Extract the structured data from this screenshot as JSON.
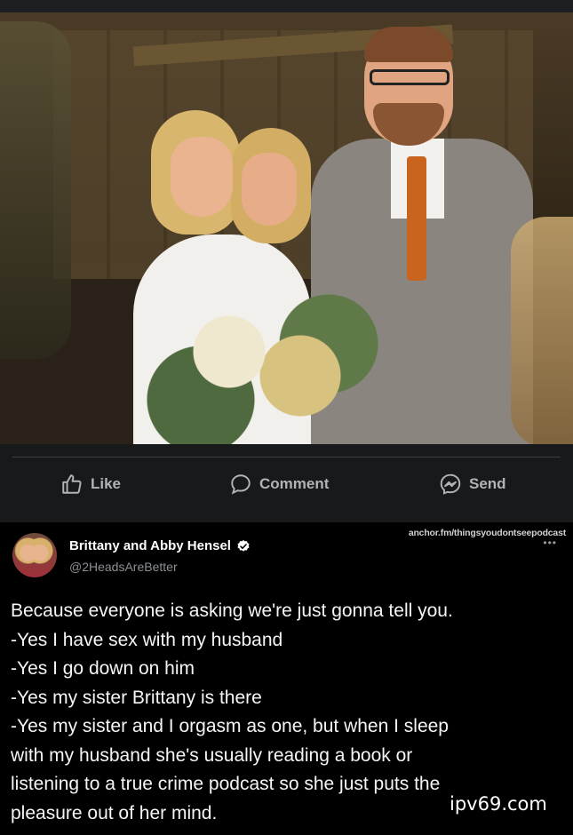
{
  "photo": {
    "icon": "wedding-photo",
    "accent_colors": {
      "tie": "#c8641e",
      "suit": "#8b8580",
      "dress": "#f2f0ec"
    }
  },
  "actions": {
    "like": {
      "label": "Like",
      "icon": "thumbs-up-icon"
    },
    "comment": {
      "label": "Comment",
      "icon": "comment-bubble-icon"
    },
    "send": {
      "label": "Send",
      "icon": "messenger-icon"
    }
  },
  "tweet": {
    "source_link": "anchor.fm/thingsyoudontseepodcast",
    "more_icon": "•••",
    "author_name": "Brittany and Abby Hensel",
    "verified_icon": "verified-badge-icon",
    "handle": "@2HeadsAreBetter",
    "lines": [
      "Because everyone is asking we're just gonna tell you.",
      "-Yes I have sex with my husband",
      "-Yes I go down on him",
      "-Yes my sister Brittany is there",
      "-Yes my sister and I orgasm as one, but when I sleep",
      "with my husband she's usually reading a book or",
      "listening to a true crime podcast so she just puts the",
      "pleasure out of her mind."
    ]
  },
  "watermark": "ipv69.com"
}
